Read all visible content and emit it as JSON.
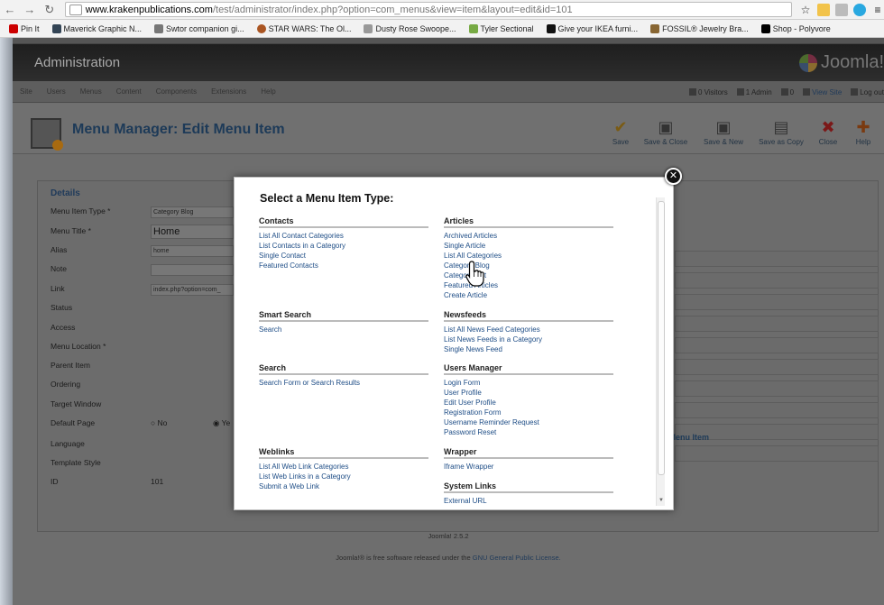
{
  "browser": {
    "url_host": "www.krakenpublications.com",
    "url_path": "/test/administrator/index.php?option=com_menus&view=item&layout=edit&id=101",
    "bookmarks": [
      "Pin It",
      "Maverick Graphic N...",
      "Swtor companion gi...",
      "STAR WARS: The Ol...",
      "Dusty Rose Swoope...",
      "Tyler Sectional",
      "Give your IKEA furni...",
      "FOSSIL® Jewelry Bra...",
      "Shop - Polyvore"
    ]
  },
  "admin": {
    "title": "Administration",
    "logo_text": "Joomla!",
    "menu": [
      "Site",
      "Users",
      "Menus",
      "Content",
      "Components",
      "Extensions",
      "Help"
    ],
    "status": {
      "visitors": "0 Visitors",
      "admins": "1 Admin",
      "messages": "0",
      "view_site": "View Site",
      "logout": "Log out"
    },
    "page_title": "Menu Manager: Edit Menu Item",
    "toolbar": [
      "Save",
      "Save & Close",
      "Save & New",
      "Save as Copy",
      "Close",
      "Help"
    ]
  },
  "details": {
    "legend": "Details",
    "labels": [
      "Menu Item Type *",
      "Menu Title *",
      "Alias",
      "Note",
      "Link",
      "Status",
      "Access",
      "Menu Location *",
      "Parent Item",
      "Ordering",
      "Target Window",
      "Default Page",
      "Language",
      "Template Style",
      "ID"
    ],
    "menu_item_type": "Category Blog",
    "menu_title": "Home",
    "alias": "home",
    "link": "index.php?option=com_",
    "default_no": "No",
    "default_yes": "Ye",
    "id": "101",
    "right_label": "s Menu Item"
  },
  "footer": {
    "version": "Joomla! 2.5.2",
    "license_pre": "Joomla!® is free software released under the",
    "license_link": "GNU General Public License."
  },
  "modal": {
    "title": "Select a Menu Item Type:",
    "left": [
      {
        "name": "Contacts",
        "items": [
          "List All Contact Categories",
          "List Contacts in a Category",
          "Single Contact",
          "Featured Contacts"
        ]
      },
      {
        "name": "Smart Search",
        "items": [
          "Search"
        ]
      },
      {
        "name": "Search",
        "items": [
          "Search Form or Search Results"
        ]
      },
      {
        "name": "Weblinks",
        "items": [
          "List All Web Link Categories",
          "List Web Links in a Category",
          "Submit a Web Link"
        ]
      }
    ],
    "right": [
      {
        "name": "Articles",
        "items": [
          "Archived Articles",
          "Single Article",
          "List All Categories",
          "Category Blog",
          "Category List",
          "Featured Articles",
          "Create Article"
        ]
      },
      {
        "name": "Newsfeeds",
        "items": [
          "List All News Feed Categories",
          "List News Feeds in a Category",
          "Single News Feed"
        ]
      },
      {
        "name": "Users Manager",
        "items": [
          "Login Form",
          "User Profile",
          "Edit User Profile",
          "Registration Form",
          "Username Reminder Request",
          "Password Reset"
        ]
      },
      {
        "name": "Wrapper",
        "items": [
          "Iframe Wrapper"
        ]
      },
      {
        "name": "System Links",
        "items": [
          "External URL"
        ]
      }
    ]
  }
}
